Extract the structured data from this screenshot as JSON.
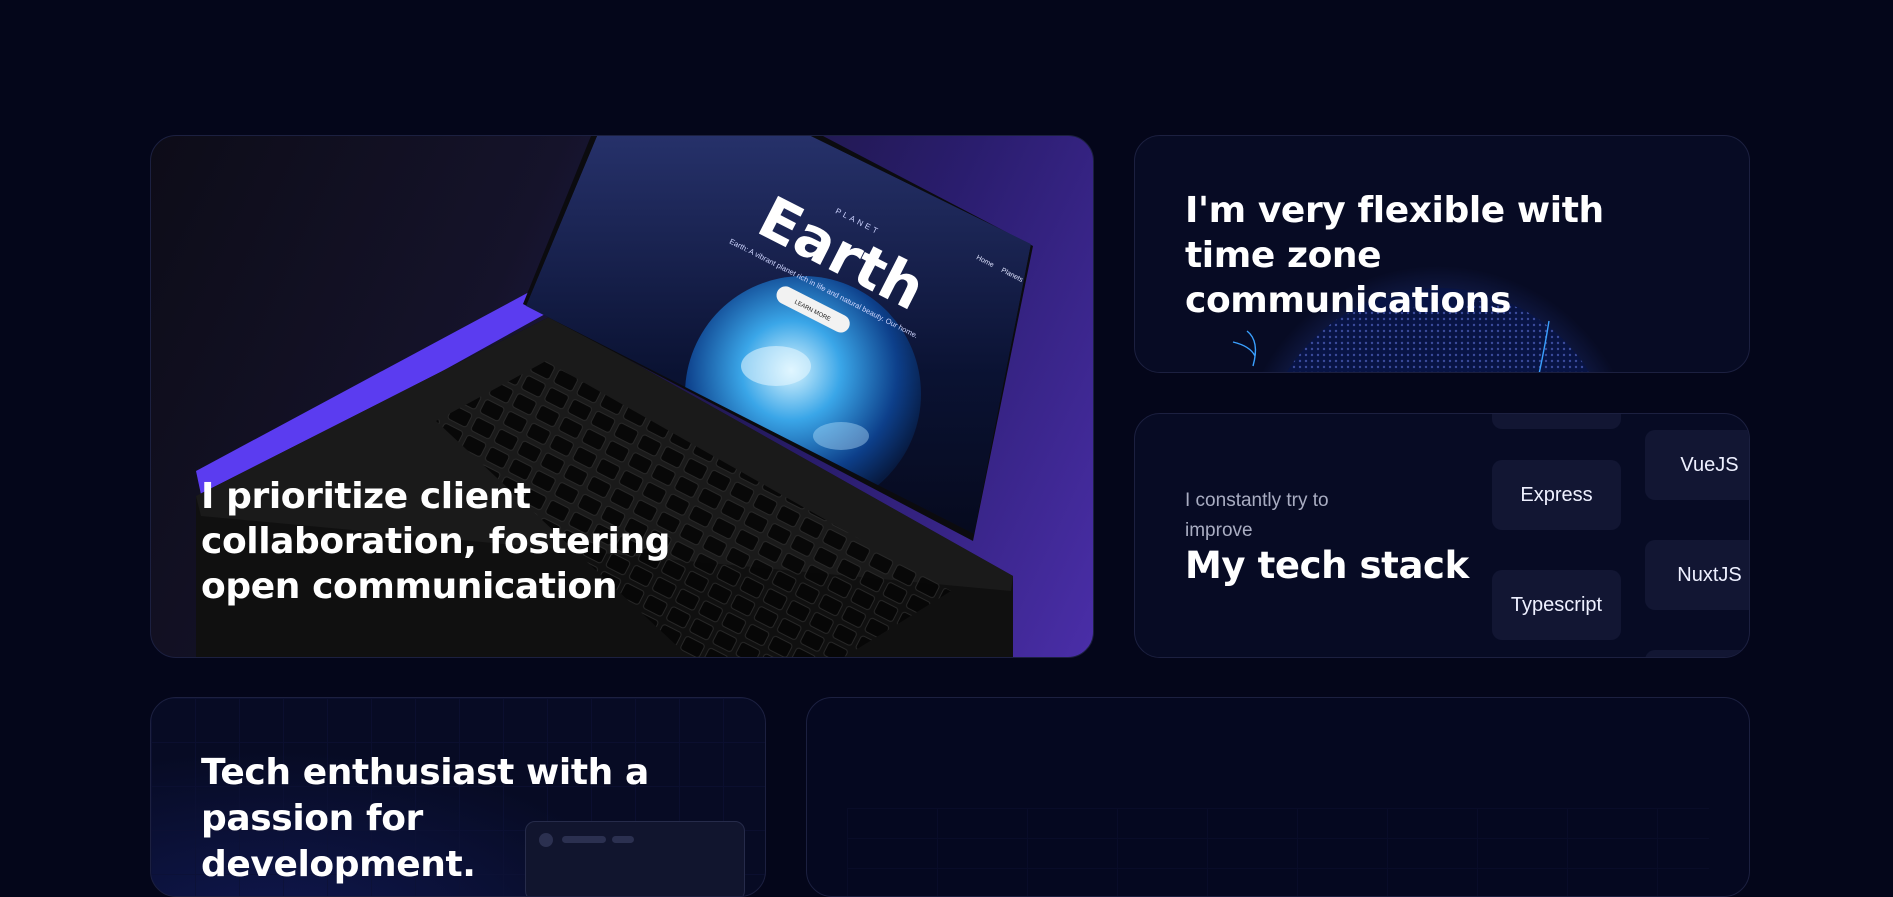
{
  "cards": {
    "collaboration": {
      "caption": "I prioritize client collaboration, fostering open communication",
      "laptop_screen": {
        "eyebrow": "PLANET",
        "headline": "Earth",
        "tagline": "Earth: A vibrant planet rich in life and natural beauty. Our home.",
        "cta": "LEARN MORE",
        "nav": [
          "Home",
          "Planets"
        ]
      }
    },
    "timezone": {
      "title": "I'm very flexible with time zone communications"
    },
    "stack": {
      "subtitle": "I constantly try to improve",
      "title": "My tech stack",
      "items": [
        "Express",
        "Typescript",
        "VueJS",
        "NuxtJS"
      ]
    },
    "enthusiast": {
      "title": "Tech enthusiast with a passion for development."
    }
  },
  "colors": {
    "background": "#04061a",
    "accent_purple": "#5b3cf0",
    "card_border": "#1c2040",
    "pill_bg": "#121633"
  }
}
